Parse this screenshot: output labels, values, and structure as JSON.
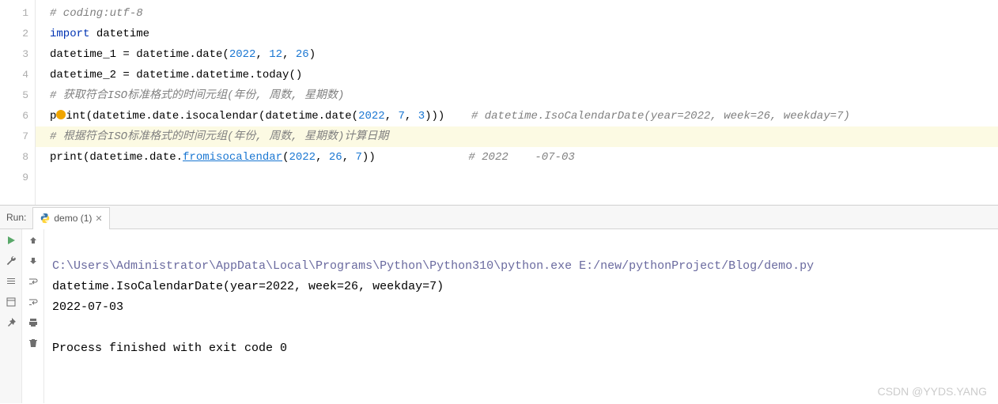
{
  "editor": {
    "lines": [
      "1",
      "2",
      "3",
      "4",
      "5",
      "6",
      "7",
      "8",
      "9"
    ],
    "code": {
      "l1_comment": "# coding:utf-8",
      "l2_kw": "import",
      "l2_rest": " datetime",
      "l3_a": "datetime_1 = datetime.date(",
      "l3_n1": "2022",
      "l3_s1": ", ",
      "l3_n2": "12",
      "l3_s2": ", ",
      "l3_n3": "26",
      "l3_e": ")",
      "l4": "datetime_2 = datetime.datetime.today()",
      "l5_comment": "# 获取符合ISO标准格式的时间元组(年份, 周数, 星期数)",
      "l6_a": "p",
      "l6_b": "int(datetime.date.isocalendar(datetime.date(",
      "l6_n1": "2022",
      "l6_s1": ", ",
      "l6_n2": "7",
      "l6_s2": ", ",
      "l6_n3": "3",
      "l6_e": ")))    ",
      "l6_c": "# datetime.IsoCalendarDate(year=2022, week=26, weekday=7)",
      "l7_comment": "# 根据符合ISO标准格式的时间元组(年份, 周数, 星期数)计算日期",
      "l8_a": "print(datetime.date.",
      "l8_link": "fromisocalendar",
      "l8_b": "(",
      "l8_n1": "2022",
      "l8_s1": ", ",
      "l8_n2": "26",
      "l8_s2": ", ",
      "l8_n3": "7",
      "l8_e": "))              ",
      "l8_c": "# 2022    -07-03"
    }
  },
  "run": {
    "label": "Run:",
    "tab": "demo (1)"
  },
  "console": {
    "cmd": "C:\\Users\\Administrator\\AppData\\Local\\Programs\\Python\\Python310\\python.exe E:/new/pythonProject/Blog/demo.py",
    "out1": "datetime.IsoCalendarDate(year=2022, week=26, weekday=7)",
    "out2": "2022-07-03",
    "blank": "",
    "exit": "Process finished with exit code 0"
  },
  "watermark": "CSDN @YYDS.YANG"
}
